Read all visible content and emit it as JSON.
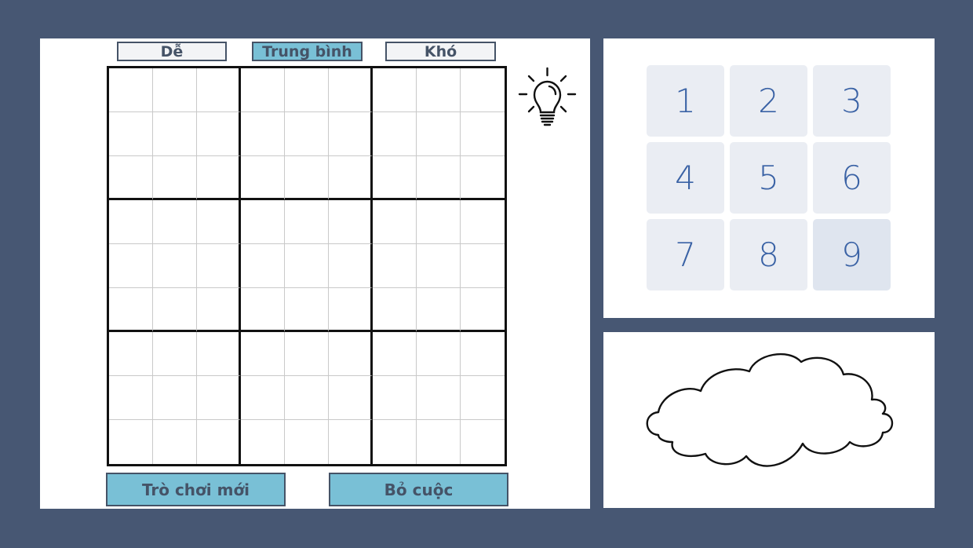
{
  "difficulty": {
    "options": [
      {
        "label": "Dễ",
        "active": false
      },
      {
        "label": "Trung bình",
        "active": true
      },
      {
        "label": "Khó",
        "active": false
      }
    ]
  },
  "board": {
    "cells": [
      [
        "",
        "",
        "",
        "",
        "",
        "",
        "",
        "",
        ""
      ],
      [
        "",
        "",
        "",
        "",
        "",
        "",
        "",
        "",
        ""
      ],
      [
        "",
        "",
        "",
        "",
        "",
        "",
        "",
        "",
        ""
      ],
      [
        "",
        "",
        "",
        "",
        "",
        "",
        "",
        "",
        ""
      ],
      [
        "",
        "",
        "",
        "",
        "",
        "",
        "",
        "",
        ""
      ],
      [
        "",
        "",
        "",
        "",
        "",
        "",
        "",
        "",
        ""
      ],
      [
        "",
        "",
        "",
        "",
        "",
        "",
        "",
        "",
        ""
      ],
      [
        "",
        "",
        "",
        "",
        "",
        "",
        "",
        "",
        ""
      ],
      [
        "",
        "",
        "",
        "",
        "",
        "",
        "",
        "",
        ""
      ]
    ]
  },
  "hint": {
    "icon": "lightbulb-icon"
  },
  "actions": {
    "new_game_label": "Trò chơi mới",
    "give_up_label": "Bỏ cuộc"
  },
  "numpad": {
    "keys": [
      "1",
      "2",
      "3",
      "4",
      "5",
      "6",
      "7",
      "8",
      "9"
    ],
    "highlighted": "9"
  },
  "message_area": {
    "icon": "cloud-icon"
  },
  "colors": {
    "background": "#475773",
    "accent": "#79c0d6",
    "border": "#455367",
    "number_text": "#3a62a5",
    "key_bg": "#eaedf3"
  }
}
